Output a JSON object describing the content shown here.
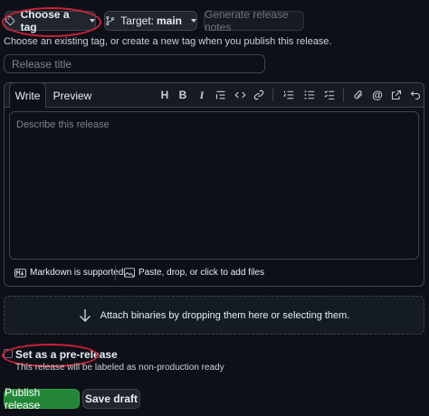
{
  "toolbar": {
    "choose_tag": "Choose a tag",
    "target_prefix": "Target:",
    "target_branch": "main",
    "generate_notes": "Generate release notes"
  },
  "hint": "Choose an existing tag, or create a new tag when you publish this release.",
  "release_title_placeholder": "Release title",
  "editor": {
    "tab_write": "Write",
    "tab_preview": "Preview",
    "placeholder": "Describe this release",
    "markdown_note": "Markdown is supported",
    "paste_note": "Paste, drop, or click to add files",
    "tools": [
      "heading-icon",
      "bold-icon",
      "italic-icon",
      "quote-icon",
      "code-icon",
      "link-icon",
      "numbered-list-icon",
      "bulleted-list-icon",
      "task-list-icon",
      "attachment-icon",
      "mention-icon",
      "reference-icon",
      "undo-icon"
    ]
  },
  "attach": "Attach binaries by dropping them here or selecting them.",
  "prerelease": {
    "label": "Set as a pre-release",
    "description": "This release will be labeled as non-production ready"
  },
  "actions": {
    "publish": "Publish release",
    "save_draft": "Save draft"
  },
  "colors": {
    "accent_green": "#238636",
    "annotation_red": "#d0203a"
  }
}
